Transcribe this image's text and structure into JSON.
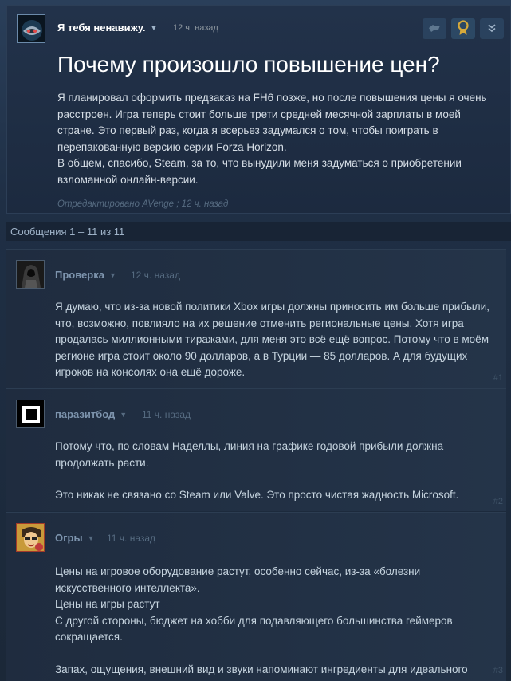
{
  "topic": {
    "author": "Я тебя ненавижу.",
    "time": "12 ч. назад",
    "title": "Почему произошло повышение цен?",
    "body": [
      "Я планировал оформить предзаказ на FH6 позже, но после повышения цены я очень расстроен. Игра теперь стоит больше трети средней месячной зарплаты в моей стране. Это первый раз, когда я всерьез задумался о том, чтобы поиграть в перепакованную версию серии Forza Horizon.",
      "В общем, спасибо, Steam, за то, что вынудили меня задуматься о приобретении взломанной онлайн-версии."
    ],
    "edited": "Отредактировано AVenge ; 12 ч. назад",
    "buttons": [
      "flag-icon",
      "award-icon",
      "expand-icon"
    ]
  },
  "messages_count": "Сообщения 1 – 11 из 11",
  "comments": [
    {
      "author": "Проверка",
      "time": "12 ч. назад",
      "number": "#1",
      "paragraphs": [
        "Я думаю, что из-за новой политики Xbox игры должны приносить им больше прибыли, что, возможно, повлияло на их решение отменить региональные цены. Хотя игра продалась миллионными тиражами, для меня это всё ещё вопрос. Потому что в моём регионе игра стоит около 90 долларов, а в Турции — 85 долларов. А для будущих игроков на консолях она ещё дороже."
      ]
    },
    {
      "author": "паразитбод",
      "time": "11 ч. назад",
      "number": "#2",
      "paragraphs": [
        "Потому что, по словам Наделлы, линия на графике годовой прибыли должна продолжать расти.",
        "",
        "Это никак не связано со Steam или Valve. Это просто чистая жадность Microsoft."
      ]
    },
    {
      "author": "Огры",
      "time": "11 ч. назад",
      "number": "#3",
      "paragraphs": [
        "Цены на игровое оборудование растут, особенно сейчас, из-за «болезни искусственного интеллекта».",
        "Цены на игры растут",
        "С другой стороны, бюджет на хобби для подавляющего большинства геймеров сокращается.",
        "",
        "Запах, ощущения, внешний вид и звуки напоминают ингредиенты для идеального шторма."
      ]
    }
  ]
}
